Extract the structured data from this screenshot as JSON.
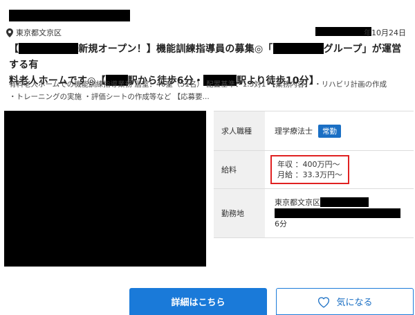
{
  "location": {
    "text": "東京都文京区"
  },
  "date": {
    "text": "年10月24日"
  },
  "title": {
    "line1_a": "【",
    "line1_b": "新規オープン！】機能訓練指導員の募集◎「",
    "line1_c": "グループ」が運営する有",
    "line2_a": "料老人ホームです◎【",
    "line2_b": "駅から徒歩6分・",
    "line2_c": "駅より徒歩10分】"
  },
  "description": {
    "line1": "有料老人ホームでの機能訓練指導業務 居室：46室（51名） 配置基準：1.5対1 【業務内容】 ・リハビリ計画の作成",
    "line2": "・トレーニングの実施 ・評価シートの作成等など 【応募要..."
  },
  "details": {
    "job_type_label": "求人職種",
    "job_type_value": "理学療法士",
    "employment_badge": "常勤",
    "salary_label": "給料",
    "salary_annual": "年収 ：400万円〜",
    "salary_monthly": "月給 ：33.3万円〜",
    "workplace_label": "勤務地",
    "workplace_line1": "東京都文京区",
    "workplace_line3": "6分"
  },
  "buttons": {
    "detail": "詳細はこちら",
    "favorite": "気になる"
  },
  "colors": {
    "accent": "#1a7ad9",
    "highlight_border": "#e02020",
    "redaction": "#000000"
  },
  "icons": {
    "location": "map-pin-icon",
    "favorite": "heart-icon"
  }
}
